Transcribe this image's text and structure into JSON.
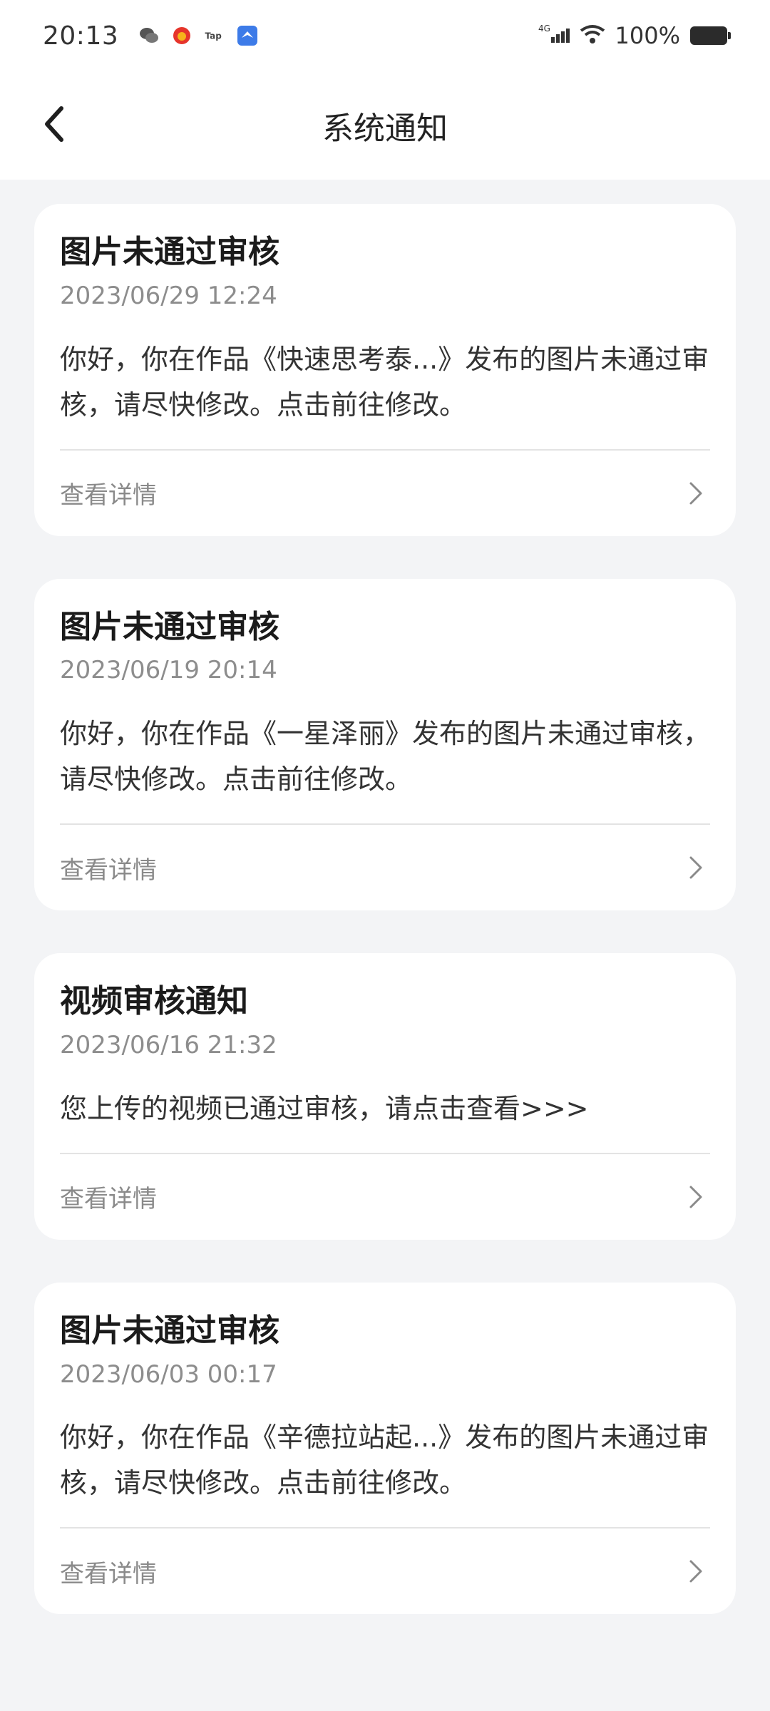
{
  "status_bar": {
    "time": "20:13",
    "battery": "100%",
    "network": "4G",
    "apps": [
      "wechat-icon",
      "weibo-icon",
      "tap-icon",
      "app-icon"
    ]
  },
  "header": {
    "title": "系统通知"
  },
  "notifications": [
    {
      "title": "图片未通过审核",
      "time": "2023/06/29 12:24",
      "body": "你好，你在作品《快速思考泰...》发布的图片未通过审核，请尽快修改。点击前往修改。",
      "detail_label": "查看详情"
    },
    {
      "title": "图片未通过审核",
      "time": "2023/06/19 20:14",
      "body": "你好，你在作品《一星泽丽》发布的图片未通过审核，请尽快修改。点击前往修改。",
      "detail_label": "查看详情"
    },
    {
      "title": "视频审核通知",
      "time": "2023/06/16 21:32",
      "body": "您上传的视频已通过审核，请点击查看>>>",
      "detail_label": "查看详情"
    },
    {
      "title": "图片未通过审核",
      "time": "2023/06/03 00:17",
      "body": "你好，你在作品《辛德拉站起...》发布的图片未通过审核，请尽快修改。点击前往修改。",
      "detail_label": "查看详情"
    }
  ]
}
